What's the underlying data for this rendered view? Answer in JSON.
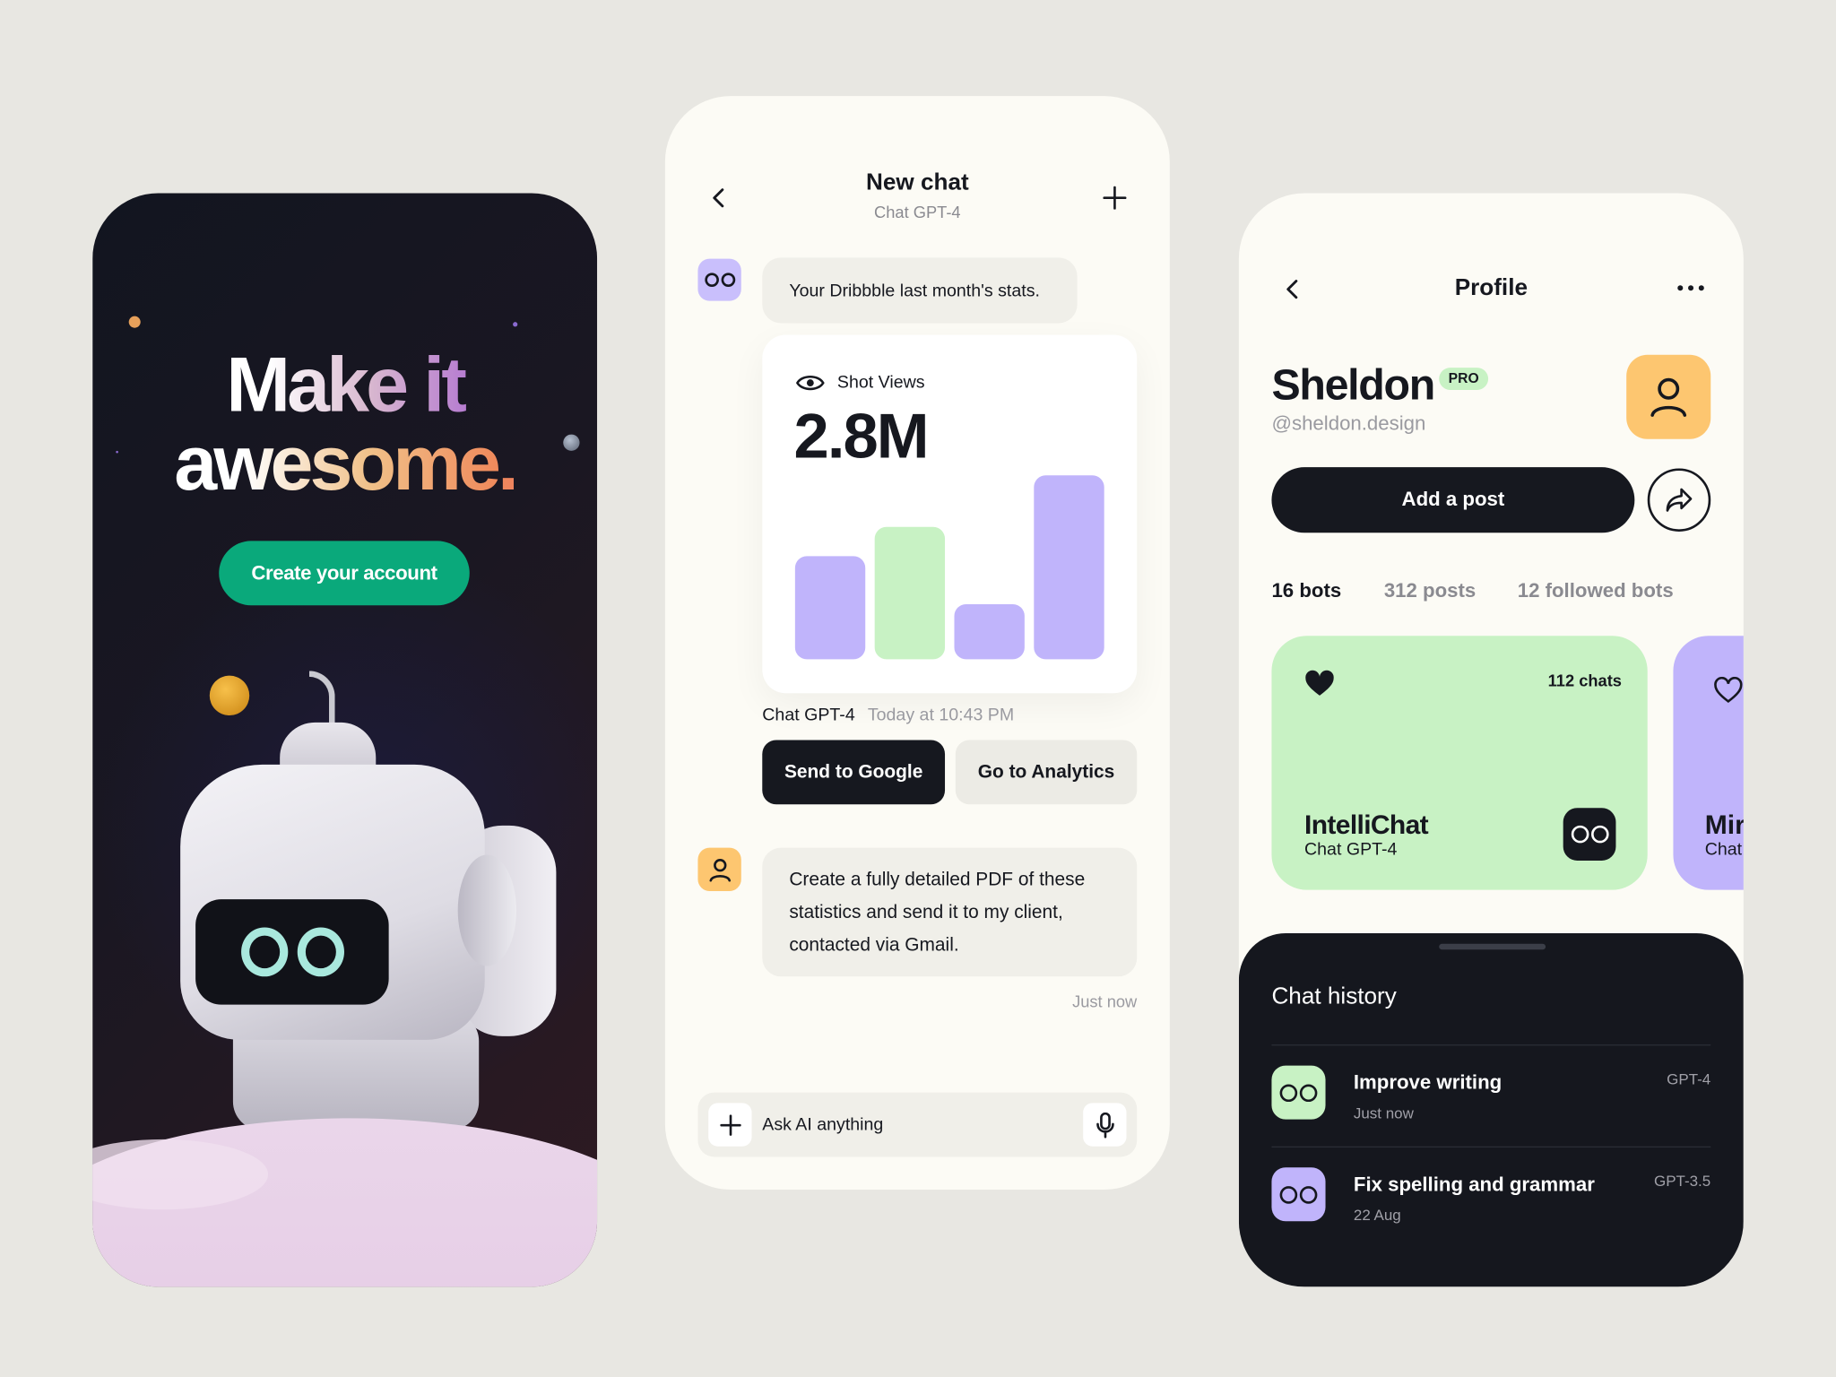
{
  "welcome": {
    "headline_line1": "Make it",
    "headline_line2": "awesome.",
    "cta_label": "Create your account",
    "cta_color": "#0aa97b"
  },
  "chat": {
    "title": "New chat",
    "subtitle": "Chat GPT-4",
    "bot_message": "Your Dribbble last month's stats.",
    "stats_card": {
      "label": "Shot Views",
      "value": "2.8M"
    },
    "meta_author": "Chat GPT-4",
    "meta_time": "Today at 10:43 PM",
    "actions": [
      "Send to Google",
      "Go to Analytics"
    ],
    "user_message": "Create a fully detailed PDF of these statistics and send it to my client, contacted via Gmail.",
    "user_time": "Just now",
    "input_placeholder": "Ask AI anything"
  },
  "chart_data": {
    "type": "bar",
    "categories": [
      "",
      "",
      "",
      ""
    ],
    "values": [
      0.56,
      0.72,
      0.3,
      1.0
    ],
    "colors": [
      "#c0b4fb",
      "#c8f2c4",
      "#c0b4fb",
      "#c0b4fb"
    ],
    "title": "",
    "xlabel": "",
    "ylabel": "",
    "ylim": [
      0,
      1
    ],
    "grid": false
  },
  "profile": {
    "title": "Profile",
    "name": "Sheldon",
    "badge": "PRO",
    "handle": "@sheldon.design",
    "add_post_label": "Add a post",
    "stats": [
      "16 bots",
      "312 posts",
      "12 followed bots"
    ],
    "bots": [
      {
        "name": "IntelliChat",
        "model": "Chat GPT-4",
        "chats": "112 chats",
        "color": "#c8f2c4"
      },
      {
        "name": "Mir",
        "model": "Chat",
        "color": "#c0b4fb"
      }
    ],
    "history_title": "Chat history",
    "history": [
      {
        "title": "Improve writing",
        "time": "Just now",
        "model": "GPT-4",
        "color": "#c8f2c4"
      },
      {
        "title": "Fix spelling and grammar",
        "time": "22 Aug",
        "model": "GPT-3.5",
        "color": "#c0b4fb"
      }
    ]
  }
}
